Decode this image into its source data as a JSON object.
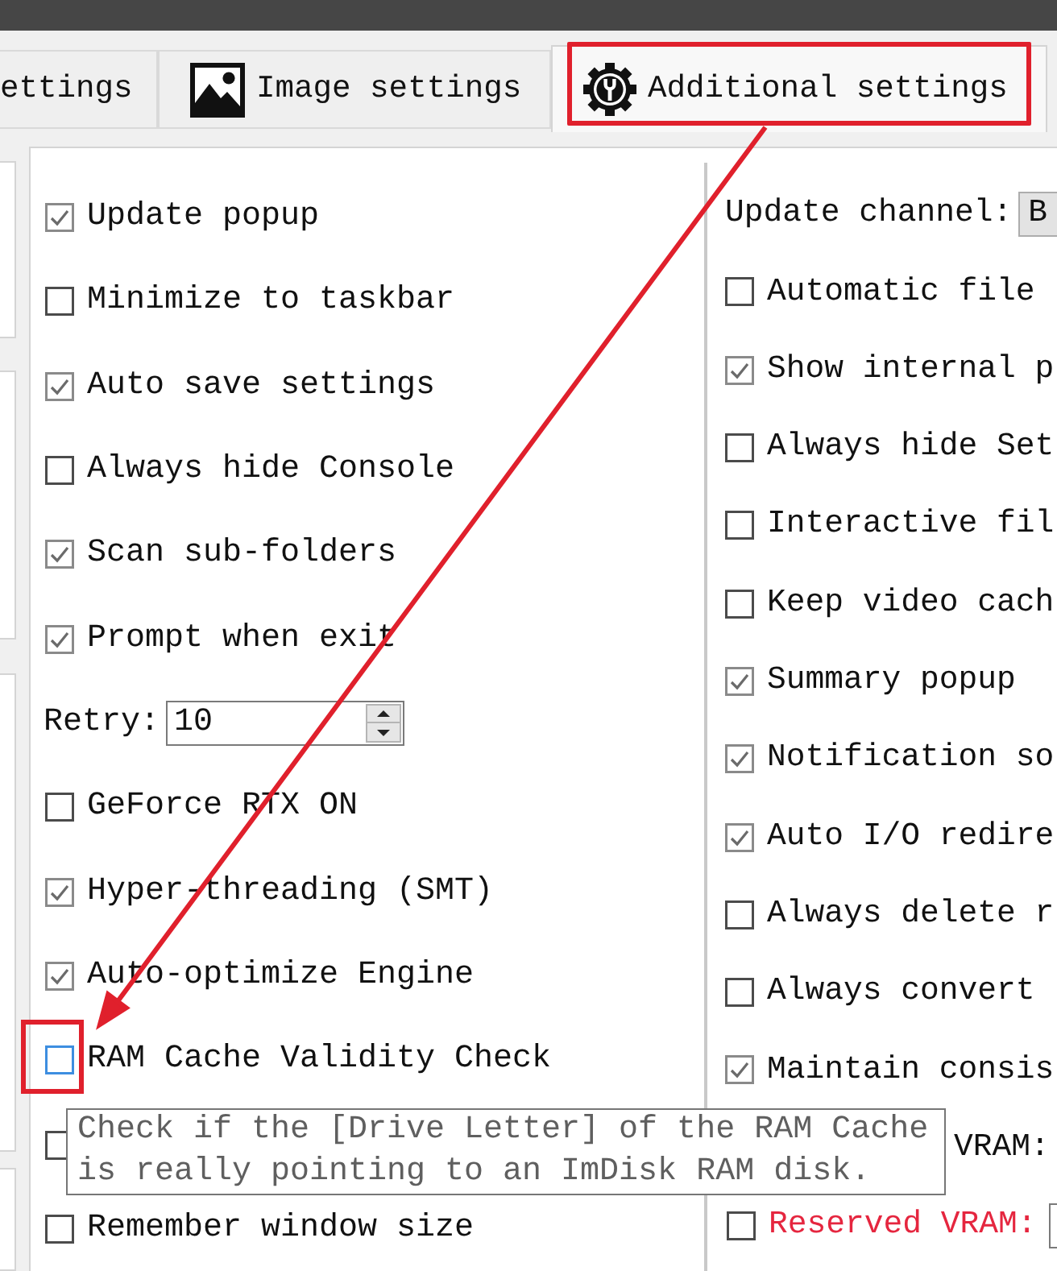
{
  "tabs": [
    {
      "kind": "plain",
      "label": "ettings",
      "selected": false
    },
    {
      "kind": "image",
      "label": "Image settings",
      "selected": false
    },
    {
      "kind": "settings",
      "label": "Additional settings",
      "selected": true,
      "highlighted": true
    }
  ],
  "left_options": [
    {
      "kind": "checkbox",
      "label": "Update popup",
      "checked": true
    },
    {
      "kind": "checkbox",
      "label": "Minimize to taskbar",
      "checked": false
    },
    {
      "kind": "checkbox",
      "label": "Auto save settings",
      "checked": true
    },
    {
      "kind": "checkbox",
      "label": "Always hide Console",
      "checked": false
    },
    {
      "kind": "checkbox",
      "label": "Scan sub-folders",
      "checked": true
    },
    {
      "kind": "checkbox",
      "label": "Prompt when exit",
      "checked": true
    },
    {
      "kind": "spin",
      "label": "Retry:",
      "value": "10"
    },
    {
      "kind": "checkbox",
      "label": "GeForce RTX ON",
      "checked": false
    },
    {
      "kind": "checkbox",
      "label": "Hyper-threading (SMT)",
      "checked": true
    },
    {
      "kind": "checkbox",
      "label": "Auto-optimize Engine",
      "checked": true
    },
    {
      "kind": "checkbox",
      "label": "RAM Cache Validity Check",
      "checked": false,
      "hovered": true,
      "highlighted": true
    },
    {
      "kind": "checkbox",
      "checked": false
    },
    {
      "kind": "checkbox",
      "label": "Remember window size",
      "checked": false
    }
  ],
  "right_options": [
    {
      "kind": "select",
      "label": "Update channel:",
      "value": "B"
    },
    {
      "kind": "checkbox",
      "label": "Automatic file",
      "checked": false
    },
    {
      "kind": "checkbox",
      "label": "Show internal p",
      "checked": true
    },
    {
      "kind": "checkbox",
      "label": "Always hide Set",
      "checked": false
    },
    {
      "kind": "checkbox",
      "label": "Interactive fil",
      "checked": false
    },
    {
      "kind": "checkbox",
      "label": "Keep video cach",
      "checked": false
    },
    {
      "kind": "checkbox",
      "label": "Summary popup",
      "checked": true
    },
    {
      "kind": "checkbox",
      "label": "Notification so",
      "checked": true
    },
    {
      "kind": "checkbox",
      "label": "Auto I/O redire",
      "checked": true
    },
    {
      "kind": "checkbox",
      "label": "Always delete r",
      "checked": false
    },
    {
      "kind": "checkbox",
      "label": "Always convert",
      "checked": false
    },
    {
      "kind": "checkbox",
      "label": "Maintain consis",
      "checked": true
    },
    {
      "kind": "label",
      "label": "VRAM:"
    },
    {
      "kind": "checkbox_field",
      "label": "Reserved VRAM:",
      "checked": false,
      "color": "#e5263f"
    }
  ],
  "tooltip": {
    "text": "Check if the [Drive Letter] of the RAM Cache is really pointing to an ImDisk RAM disk."
  }
}
